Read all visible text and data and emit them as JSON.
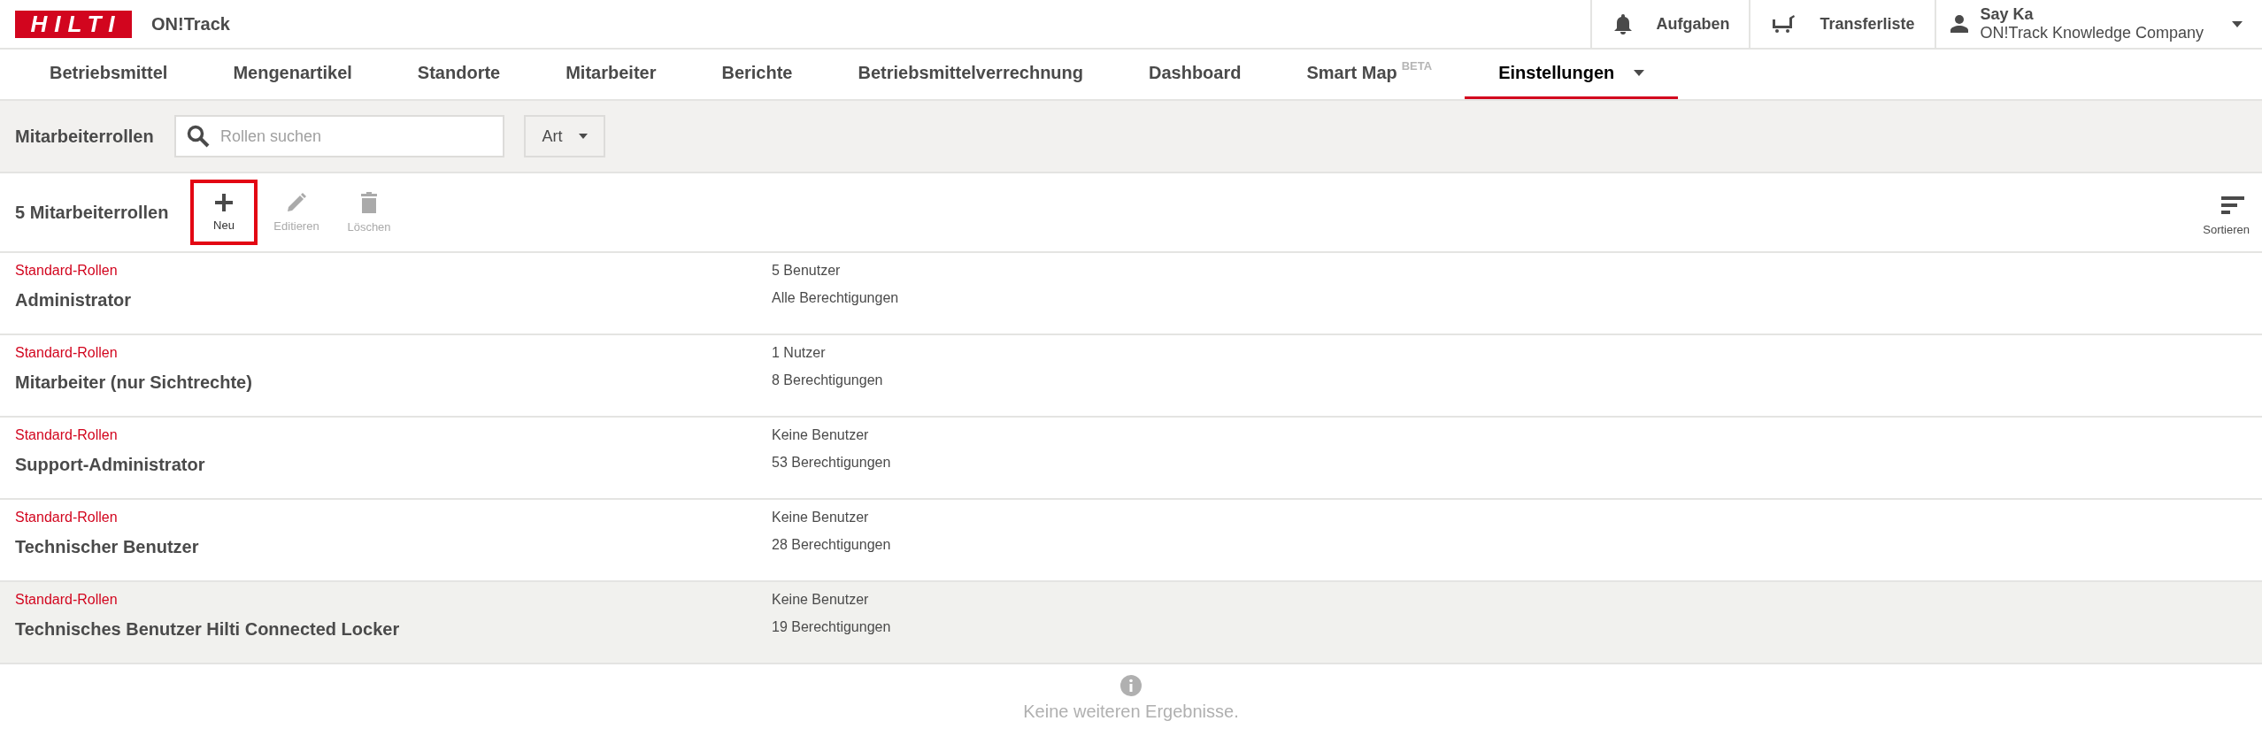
{
  "header": {
    "logo": "HILTI",
    "app_name": "ON!Track",
    "actions": [
      {
        "kind": "bell",
        "label": "Aufgaben"
      },
      {
        "kind": "cart",
        "label": "Transferliste"
      }
    ],
    "user": {
      "name": "Say Ka",
      "company": "ON!Track Knowledge Company"
    }
  },
  "nav": [
    {
      "label": "Betriebsmittel",
      "selected": false
    },
    {
      "label": "Mengenartikel",
      "selected": false
    },
    {
      "label": "Standorte",
      "selected": false
    },
    {
      "label": "Mitarbeiter",
      "selected": false
    },
    {
      "label": "Berichte",
      "selected": false
    },
    {
      "label": "Betriebsmittelverrechnung",
      "selected": false
    },
    {
      "label": "Dashboard",
      "selected": false
    },
    {
      "label": "Smart Map",
      "badge": "BETA",
      "selected": false
    },
    {
      "label": "Einstellungen",
      "dropdown": true,
      "selected": true
    }
  ],
  "filter_bar": {
    "title": "Mitarbeiterrollen",
    "search": {
      "placeholder": "Rollen suchen"
    },
    "type_filter": "Art"
  },
  "toolbar": {
    "count": "5 Mitarbeiterrollen",
    "actions": [
      {
        "kind": "plus",
        "label": "Neu",
        "disabled": false,
        "highlighted": true
      },
      {
        "kind": "pencil",
        "label": "Editieren",
        "disabled": true,
        "highlighted": false
      },
      {
        "kind": "trash",
        "label": "Löschen",
        "disabled": true,
        "highlighted": false
      }
    ],
    "sort": "Sortieren"
  },
  "roles": [
    {
      "category": "Standard-Rollen",
      "name": "Administrator",
      "users": "5 Benutzer",
      "permissions": "Alle Berechtigungen",
      "selected": false
    },
    {
      "category": "Standard-Rollen",
      "name": "Mitarbeiter (nur Sichtrechte)",
      "users": "1 Nutzer",
      "permissions": "8 Berechtigungen",
      "selected": false
    },
    {
      "category": "Standard-Rollen",
      "name": "Support-Administrator",
      "users": "Keine Benutzer",
      "permissions": "53 Berechtigungen",
      "selected": false
    },
    {
      "category": "Standard-Rollen",
      "name": "Technischer Benutzer",
      "users": "Keine Benutzer",
      "permissions": "28 Berechtigungen",
      "selected": false
    },
    {
      "category": "Standard-Rollen",
      "name": "Technisches Benutzer Hilti Connected Locker",
      "users": "Keine Benutzer",
      "permissions": "19 Berechtigungen",
      "selected": true
    }
  ],
  "footer_message": "Keine weiteren Ergebnisse."
}
